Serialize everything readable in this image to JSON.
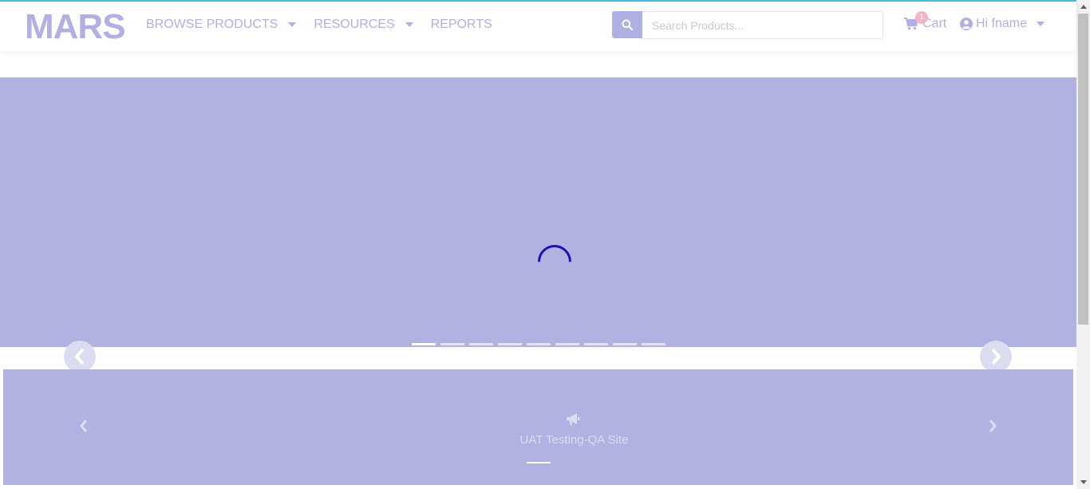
{
  "header": {
    "logo": "MARS",
    "nav": [
      {
        "label": "BROWSE PRODUCTS",
        "has_dropdown": true
      },
      {
        "label": "RESOURCES",
        "has_dropdown": true
      },
      {
        "label": "REPORTS",
        "has_dropdown": false
      }
    ],
    "search": {
      "placeholder": "Search Products...",
      "value": "",
      "icon": "search-icon"
    },
    "cart": {
      "label": "Cart",
      "count": "1",
      "icon": "shopping-cart-icon"
    },
    "user": {
      "label": "Hi fname",
      "icon": "user-circle-icon"
    }
  },
  "hero": {
    "slide_count": 9,
    "active_slide": 1,
    "loading": true
  },
  "announcement": {
    "text": "UAT Testing-QA Site",
    "icon": "megaphone-icon"
  },
  "colors": {
    "accent": "#b0b0e2",
    "hero_bg": "#b1b1e2",
    "spinner": "#1a13b0",
    "top_line": "#4ab8e6",
    "badge": "#f3b5c6"
  }
}
